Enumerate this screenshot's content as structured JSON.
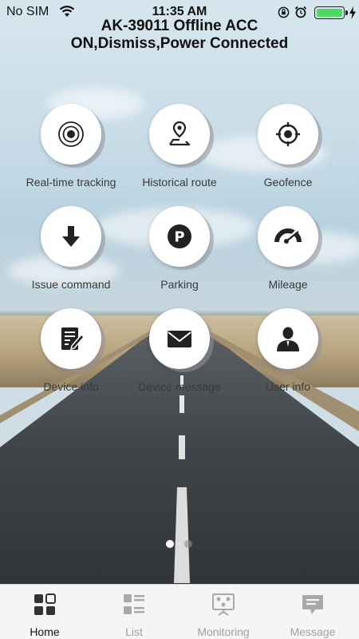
{
  "status_bar": {
    "carrier": "No SIM",
    "time": "11:35 AM",
    "battery_level": 1.0,
    "wifi_icon": "wifi-icon",
    "lock_icon": "orientation-lock-icon",
    "alarm_icon": "alarm-icon",
    "charging_icon": "bolt-icon"
  },
  "header": {
    "title_line1": "AK-39011 Offline ACC",
    "title_line2": "ON,Dismiss,Power Connected"
  },
  "functions": [
    {
      "label": "Real-time tracking",
      "icon": "target-icon"
    },
    {
      "label": "Historical route",
      "icon": "route-pin-icon"
    },
    {
      "label": "Geofence",
      "icon": "crosshair-icon"
    },
    {
      "label": "Issue command",
      "icon": "arrow-down-icon"
    },
    {
      "label": "Parking",
      "icon": "parking-icon"
    },
    {
      "label": "Mileage",
      "icon": "speedometer-icon"
    },
    {
      "label": "Device info",
      "icon": "document-edit-icon"
    },
    {
      "label": "Device message",
      "icon": "envelope-icon"
    },
    {
      "label": "User info",
      "icon": "user-icon"
    }
  ],
  "pager": {
    "total": 2,
    "current": 1
  },
  "tabs": [
    {
      "label": "Home",
      "icon": "home-grid-icon",
      "active": true
    },
    {
      "label": "List",
      "icon": "list-icon",
      "active": false
    },
    {
      "label": "Monitoring",
      "icon": "monitor-icon",
      "active": false
    },
    {
      "label": "Message",
      "icon": "message-icon",
      "active": false
    }
  ],
  "colors": {
    "battery": "#4cd964",
    "icon_dark": "#222222",
    "tab_active": "#111111",
    "tab_inactive": "#a0a0a0"
  }
}
